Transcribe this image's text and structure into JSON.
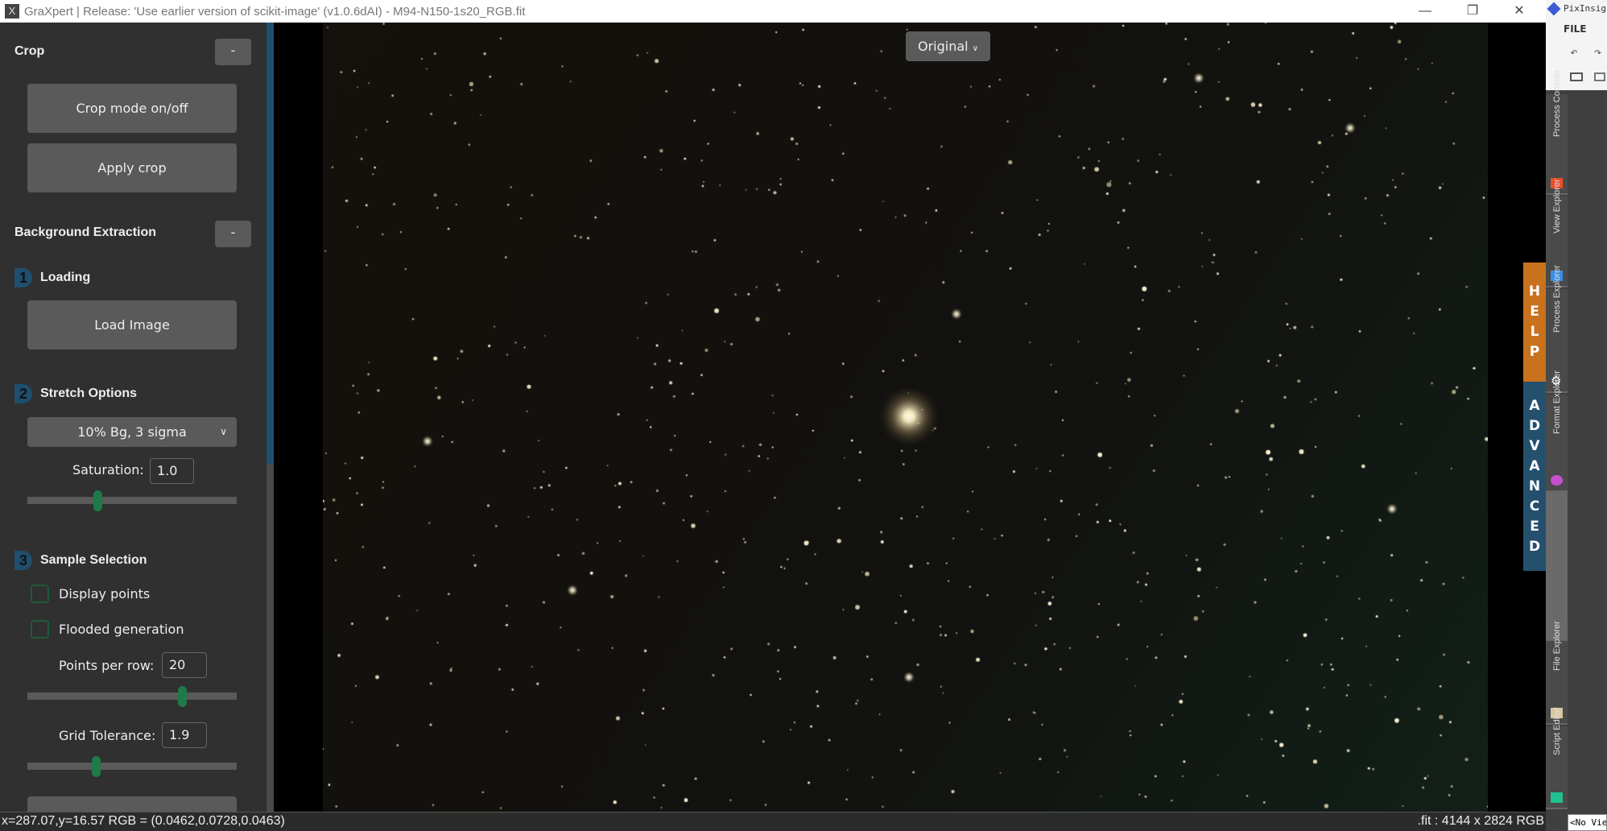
{
  "window": {
    "title": "GraXpert | Release: 'Use earlier version of scikit-image' (v1.0.6dAI) - M94-N150-1s20_RGB.fit",
    "minimize": "—",
    "maximize": "❐",
    "close": "✕"
  },
  "left": {
    "crop": {
      "title": "Crop",
      "collapse": "-",
      "crop_mode": "Crop mode on/off",
      "apply": "Apply crop"
    },
    "bg": {
      "title": "Background Extraction",
      "collapse": "-"
    },
    "loading": {
      "num": "1",
      "title": "Loading",
      "load": "Load Image"
    },
    "stretch": {
      "num": "2",
      "title": "Stretch Options",
      "selected": "10% Bg, 3 sigma",
      "saturation_label": "Saturation:",
      "saturation": "1.0",
      "saturation_fraction": 0.33
    },
    "sample": {
      "num": "3",
      "title": "Sample Selection",
      "display_points": "Display points",
      "display_points_checked": false,
      "flooded": "Flooded generation",
      "flooded_checked": false,
      "ppr_label": "Points per row:",
      "ppr": "20",
      "ppr_fraction": 0.75,
      "tol_label": "Grid Tolerance:",
      "tol": "1.9",
      "tol_fraction": 0.32
    }
  },
  "viewer": {
    "display_mode": "Original"
  },
  "side_tabs": {
    "help": "HELP",
    "advanced": "ADVANCED"
  },
  "status": {
    "left": "x=287.07,y=16.57  RGB = (0.0462,0.0728,0.0463)",
    "right": ".fit : 4144 x 2824 RGB"
  },
  "pixinsight": {
    "title": "PixInsight",
    "menu": "FILE",
    "no_view": "<No View>",
    "tabs": [
      "Process Console",
      "View Explorer",
      "Process Explorer",
      "Format Explorer",
      "File Explorer",
      "Script Editor"
    ]
  },
  "colors": {
    "accent_green": "#1f7a4a",
    "step_blue": "#1f4e6e",
    "help": "#c8721e",
    "advanced": "#24506e"
  }
}
